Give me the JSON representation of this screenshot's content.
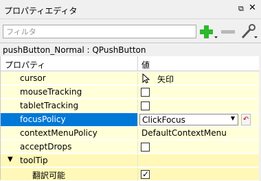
{
  "window": {
    "title": "プロパティエディタ"
  },
  "filter": {
    "placeholder": "フィルタ"
  },
  "object": {
    "label": "pushButton_Normal : QPushButton"
  },
  "table": {
    "header_property": "プロパティ",
    "header_value": "値",
    "rows": [
      {
        "name": "cursor",
        "value": "矢印"
      },
      {
        "name": "mouseTracking",
        "value": false
      },
      {
        "name": "tabletTracking",
        "value": false
      },
      {
        "name": "focusPolicy",
        "value": "ClickFocus"
      },
      {
        "name": "contextMenuPolicy",
        "value": "DefaultContextMenu"
      },
      {
        "name": "acceptDrops",
        "value": false
      },
      {
        "name": "toolTip",
        "value": ""
      },
      {
        "name": "翻訳可能",
        "value": true
      }
    ]
  },
  "colors": {
    "row_yellow": "#ffffd8",
    "row_yellow_dark": "#fff8b8",
    "selection": "#0078d7",
    "add_icon": "#2db82d"
  },
  "icons": {
    "float": "float-icon",
    "close": "close-icon",
    "add": "plus-icon",
    "remove": "minus-icon",
    "config": "wrench-icon",
    "cursor": "arrow-cursor-icon",
    "reset": "reset-icon",
    "expander": "chevron-down-icon"
  }
}
